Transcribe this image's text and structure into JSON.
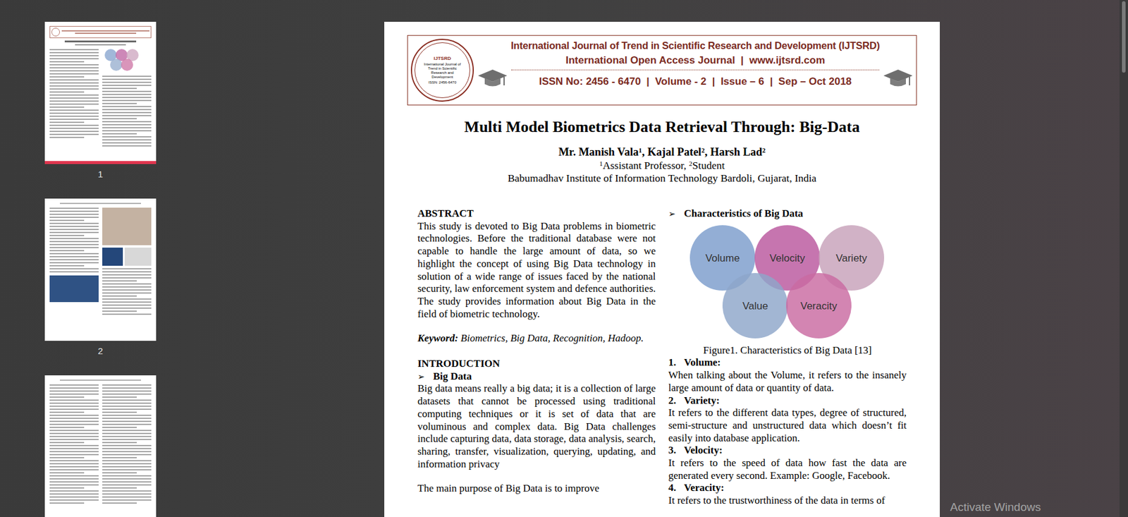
{
  "thumbnails": [
    {
      "label": "1",
      "selected": true
    },
    {
      "label": "2",
      "selected": false
    }
  ],
  "partial_thumbnail": {
    "selected": false
  },
  "document": {
    "logo": {
      "abbr": "IJTSRD",
      "name": "International Journal of Trend in Scientific Research and Development",
      "issn": "ISSN: 2456-6470"
    },
    "journal_title": "International Journal of Trend in Scientific Research and Development (IJTSRD)",
    "journal_subtitle": "International Open Access Journal  |  www.ijtsrd.com",
    "journal_issue": "ISSN No: 2456 - 6470  |  Volume - 2  |  Issue – 6  |  Sep – Oct 2018",
    "title": "Multi Model Biometrics Data Retrieval Through: Big-Data",
    "authors": [
      {
        "text": "Mr. Manish Vala",
        "sup": "1"
      },
      {
        "text": ", Kajal Patel",
        "sup": "2"
      },
      {
        "text": ", Harsh Lad",
        "sup": "2"
      }
    ],
    "roles": [
      {
        "sup": "1",
        "text": "Assistant Professor, "
      },
      {
        "sup": "2",
        "text": "Student"
      }
    ],
    "institute": "Babumadhav Institute of Information Technology Bardoli, Gujarat, India",
    "abstract_heading": "ABSTRACT",
    "abstract": "This study is devoted to Big Data problems in biometric technologies. Before the traditional database were not capable to handle the large amount of data, so we highlight the concept of using Big Data technology in solution of a wide range of issues faced by the national security, law enforcement system and defence authorities. The study provides information about Big Data in the field of biometric technology.",
    "keyword_label": "Keyword:",
    "keywords": " Biometrics, Big Data, Recognition, Hadoop.",
    "intro_heading": "INTRODUCTION",
    "bullet": "➢",
    "intro_subheading": "Big Data",
    "intro_paragraph": "Big data means really a big data; it is a collection of large datasets that cannot be processed using traditional computing techniques or it is set of data that are voluminous and complex data. Big Data challenges include capturing data, data storage, data analysis, search, sharing, transfer, visualization, querying, updating, and information privacy",
    "intro_paragraph2": "The main purpose of Big Data is to improve",
    "characteristics_heading": "Characteristics of Big Data",
    "figure": {
      "circles": [
        {
          "label": "Volume",
          "color": "#7b9ccc"
        },
        {
          "label": "Velocity",
          "color": "#b9579d"
        },
        {
          "label": "Variety",
          "color": "#c7a1ba"
        },
        {
          "label": "Value",
          "color": "#8ea6c9"
        },
        {
          "label": "Veracity",
          "color": "#c96aa1"
        }
      ],
      "caption": "Figure1. Characteristics of Big Data [13]"
    },
    "characteristics": [
      {
        "number": "1.",
        "term": "Volume:",
        "text": "When talking about the Volume, it refers to the insanely large amount of data or quantity of data."
      },
      {
        "number": "2.",
        "term": "Variety:",
        "text": "It refers to the different data types, degree of structured, semi-structure and unstructured data which doesn’t fit easily into database application."
      },
      {
        "number": "3.",
        "term": "Velocity:",
        "text": "It refers to the speed of data how fast the data are generated every second. Example: Google, Facebook."
      },
      {
        "number": "4.",
        "term": "Veracity:",
        "text": "It refers to the trustworthiness of the data in terms of"
      }
    ]
  },
  "system": {
    "activation": "Activate Windows"
  }
}
